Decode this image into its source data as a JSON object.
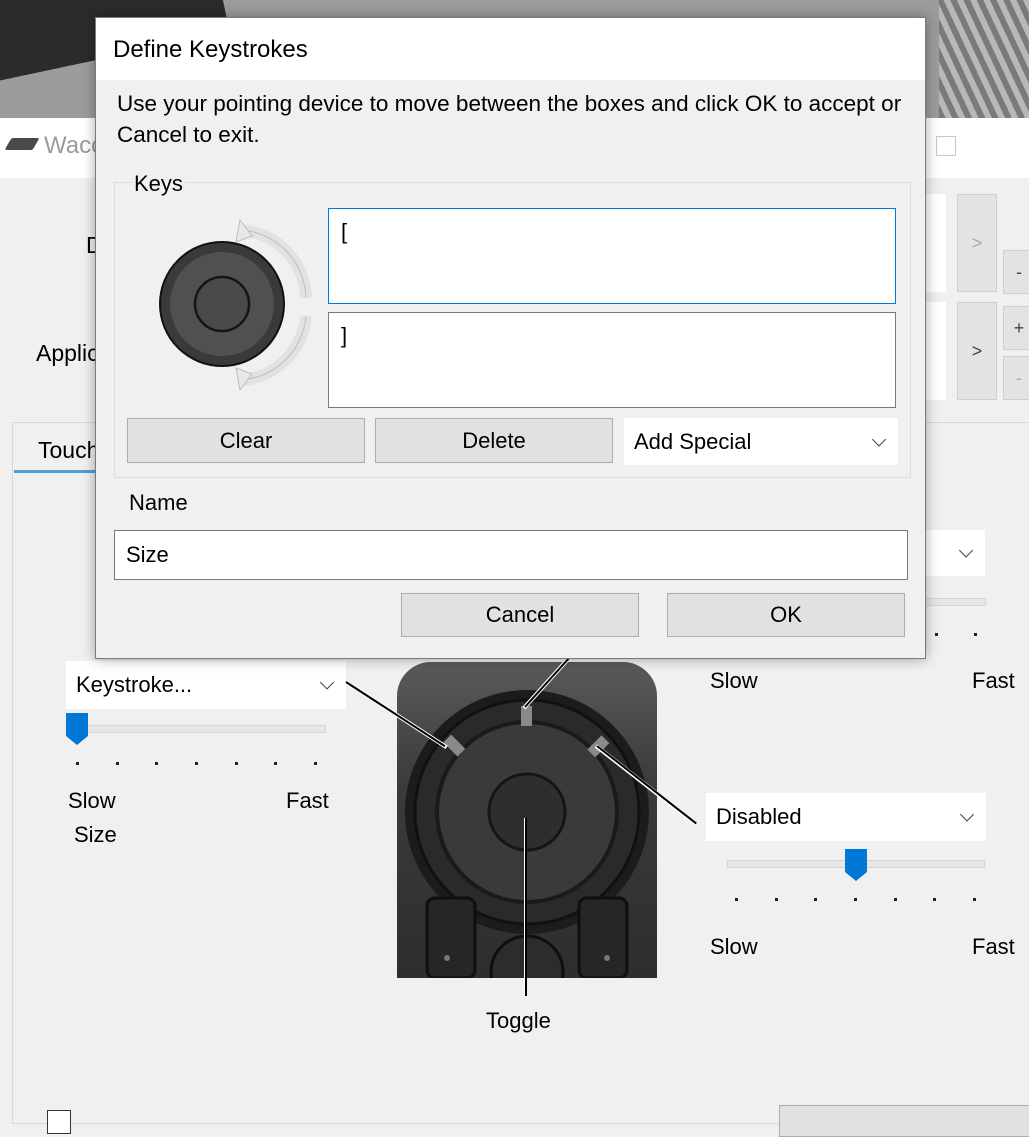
{
  "parent_window": {
    "title": "Wacom",
    "label_d": "D",
    "label_applic": "Applic",
    "tab_touch": "Touch",
    "right_buttons": [
      ">",
      ">",
      "-",
      "+",
      "-"
    ],
    "left_combo": {
      "value": "Keystroke..."
    },
    "left_slider": {
      "min_label": "Slow",
      "max_label": "Fast",
      "caption": "Size",
      "value_fraction": 0.0
    },
    "top_right_slider": {
      "min_label": "Slow",
      "max_label": "Fast"
    },
    "right_combo": {
      "value": "Disabled"
    },
    "right_slider": {
      "min_label": "Slow",
      "max_label": "Fast",
      "value_fraction": 0.5
    },
    "center_label": "Toggle"
  },
  "dialog": {
    "title": "Define Keystrokes",
    "instructions": "Use your pointing device to move between the boxes and click OK to accept or Cancel to exit.",
    "keys_group_label": "Keys",
    "key_box_1": "[",
    "key_box_2": "]",
    "clear_label": "Clear",
    "delete_label": "Delete",
    "add_special_label": "Add Special",
    "name_label": "Name",
    "name_value": "Size",
    "cancel_label": "Cancel",
    "ok_label": "OK"
  }
}
